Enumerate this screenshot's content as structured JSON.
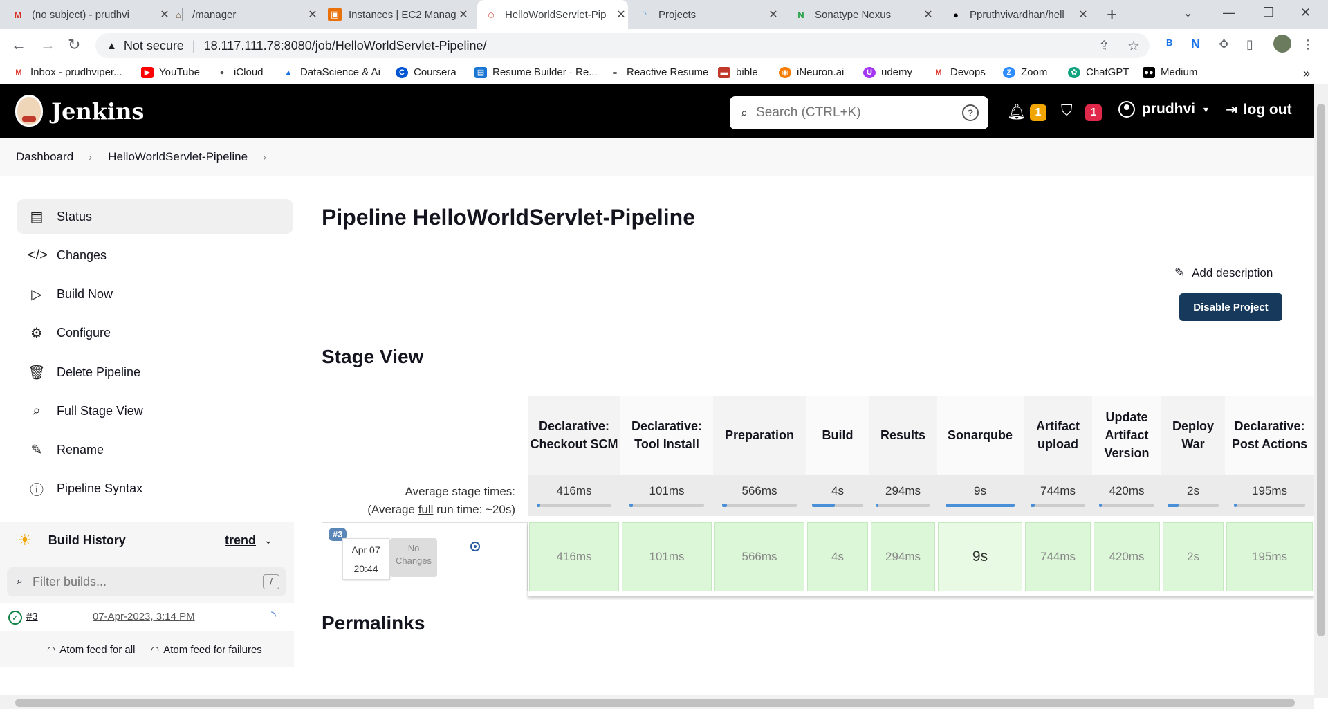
{
  "browser": {
    "tabs": [
      {
        "title": "(no subject) - prudhvi",
        "icon": "gmail-icon"
      },
      {
        "title": "/manager",
        "icon": "tomcat-icon"
      },
      {
        "title": "Instances | EC2 Manag",
        "icon": "aws-icon"
      },
      {
        "title": "HelloWorldServlet-Pip",
        "icon": "jenkins-icon",
        "active": true
      },
      {
        "title": "Projects",
        "icon": "sonarqube-icon"
      },
      {
        "title": "Sonatype Nexus",
        "icon": "nexus-icon"
      },
      {
        "title": "Ppruthvivardhan/hell",
        "icon": "github-icon"
      }
    ],
    "security": "Not secure",
    "url": "18.117.111.78:8080/job/HelloWorldServlet-Pipeline/",
    "bookmarks": [
      {
        "label": "Inbox - prudhviper...",
        "color": "#d93025"
      },
      {
        "label": "YouTube",
        "color": "#ff0000"
      },
      {
        "label": "iCloud",
        "color": "#555555"
      },
      {
        "label": "DataScience & Ai",
        "color": "#1a73e8"
      },
      {
        "label": "Coursera",
        "color": "#0056d2"
      },
      {
        "label": "Resume Builder · Re...",
        "color": "#1976d2"
      },
      {
        "label": "Reactive Resume",
        "color": "#333333"
      },
      {
        "label": "bible",
        "color": "#c0392b"
      },
      {
        "label": "iNeuron.ai",
        "color": "#f57c00"
      },
      {
        "label": "udemy",
        "color": "#a435f0"
      },
      {
        "label": "Devops",
        "color": "#d93025"
      },
      {
        "label": "Zoom",
        "color": "#2d8cff"
      },
      {
        "label": "ChatGPT",
        "color": "#10a37f"
      },
      {
        "label": "Medium",
        "color": "#000000"
      }
    ]
  },
  "jenkins": {
    "title": "Jenkins",
    "search_placeholder": "Search (CTRL+K)",
    "notifications_count": "1",
    "security_count": "1",
    "user": "prudhvi",
    "logout": "log out",
    "colors": {
      "notif": "#f0a500",
      "security": "#e0294a",
      "header": "#000000"
    }
  },
  "breadcrumbs": [
    "Dashboard",
    "HelloWorldServlet-Pipeline"
  ],
  "sidebar": {
    "items": [
      {
        "label": "Status",
        "icon": "status-icon"
      },
      {
        "label": "Changes",
        "icon": "code-icon"
      },
      {
        "label": "Build Now",
        "icon": "play-icon"
      },
      {
        "label": "Configure",
        "icon": "gear-icon"
      },
      {
        "label": "Delete Pipeline",
        "icon": "trash-icon"
      },
      {
        "label": "Full Stage View",
        "icon": "search-icon"
      },
      {
        "label": "Rename",
        "icon": "pencil-icon"
      },
      {
        "label": "Pipeline Syntax",
        "icon": "help-icon"
      }
    ],
    "build_history": {
      "title": "Build History",
      "trend": "trend",
      "filter_placeholder": "Filter builds...",
      "filter_shortcut": "/",
      "builds": [
        {
          "number": "#3",
          "date": "07-Apr-2023, 3:14 PM"
        }
      ],
      "atom_all": "Atom feed for all",
      "atom_failures": "Atom feed for failures"
    }
  },
  "main": {
    "title": "Pipeline HelloWorldServlet-Pipeline",
    "add_description": "Add description",
    "disable_button": "Disable Project",
    "stage_view_title": "Stage View",
    "permalinks_title": "Permalinks",
    "avg_stage_label": "Average stage times:",
    "avg_run_prefix": "(Average ",
    "avg_run_full": "full",
    "avg_run_suffix": " run time: ~20s)",
    "run": {
      "tag": "#3",
      "date": "Apr 07",
      "time": "20:44",
      "changes": "No Changes"
    },
    "stages": [
      {
        "name": "Declarative: Checkout SCM",
        "avg": "416ms",
        "run": "416ms",
        "fill": 0.04
      },
      {
        "name": "Declarative: Tool Install",
        "avg": "101ms",
        "run": "101ms",
        "fill": 0.01
      },
      {
        "name": "Preparation",
        "avg": "566ms",
        "run": "566ms",
        "fill": 0.06
      },
      {
        "name": "Build",
        "avg": "4s",
        "run": "4s",
        "fill": 0.44
      },
      {
        "name": "Results",
        "avg": "294ms",
        "run": "294ms",
        "fill": 0.03
      },
      {
        "name": "Sonarqube",
        "avg": "9s",
        "run": "9s",
        "fill": 1.0
      },
      {
        "name": "Artifact upload",
        "avg": "744ms",
        "run": "744ms",
        "fill": 0.08
      },
      {
        "name": "Update Artifact Version",
        "avg": "420ms",
        "run": "420ms",
        "fill": 0.05
      },
      {
        "name": "Deploy War",
        "avg": "2s",
        "run": "2s",
        "fill": 0.22
      },
      {
        "name": "Declarative: Post Actions",
        "avg": "195ms",
        "run": "195ms",
        "fill": 0.02
      }
    ]
  }
}
